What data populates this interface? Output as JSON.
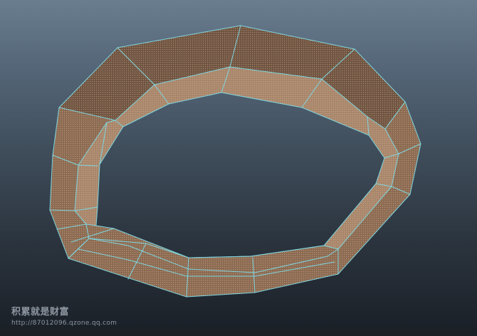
{
  "scene": {
    "object": "ring-polygon-mesh",
    "colors": {
      "background_top": "#6a7d8e",
      "background_bottom": "#1a1f26",
      "face_outer": "#8a6a52",
      "face_inner": "#a7866c",
      "face_top": "#6e5442",
      "wireframe": "#7fd6e0",
      "face_dot": "#e1b690"
    }
  },
  "watermark": {
    "title": "积累就是财富",
    "url": "http://87012096.qzone.qq.com"
  }
}
